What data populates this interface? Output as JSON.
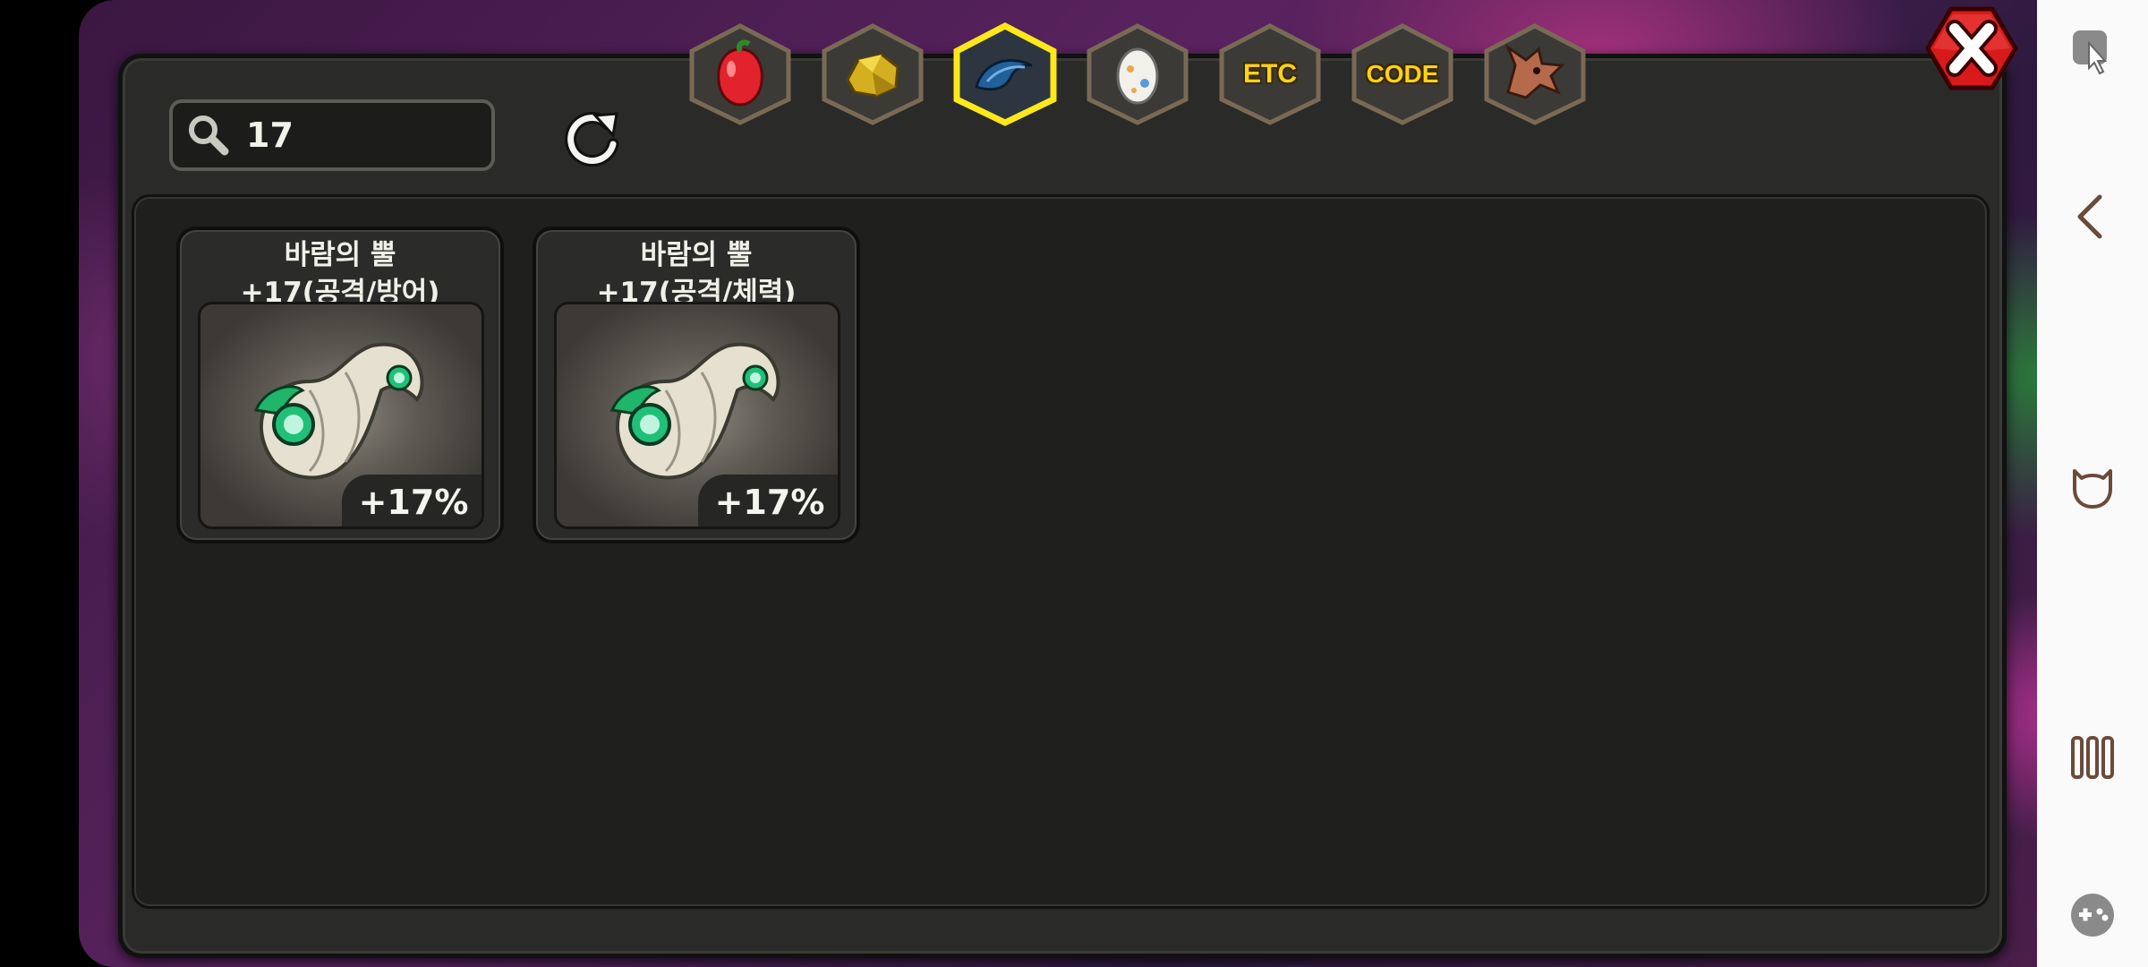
{
  "search": {
    "value": "17"
  },
  "tabs": [
    {
      "id": "fruit",
      "icon": "red-fruit-icon",
      "label": ""
    },
    {
      "id": "ore",
      "icon": "gold-ore-icon",
      "label": ""
    },
    {
      "id": "horn",
      "icon": "blue-horn-icon",
      "label": "",
      "selected": true
    },
    {
      "id": "egg",
      "icon": "egg-icon",
      "label": ""
    },
    {
      "id": "etc",
      "icon": "",
      "label": "ETC"
    },
    {
      "id": "code",
      "icon": "",
      "label": "CODE"
    },
    {
      "id": "dragon",
      "icon": "dragon-head-icon",
      "label": ""
    }
  ],
  "items": [
    {
      "name": "바람의 뿔",
      "stat": "+17(공격/방어)",
      "badge": "+17%",
      "icon": "wind-horn-icon"
    },
    {
      "name": "바람의 뿔",
      "stat": "+17(공격/체력)",
      "badge": "+17%",
      "icon": "wind-horn-icon"
    }
  ],
  "colors": {
    "selected_tab_border": "#ffe81a",
    "tab_label": "#ffd21a",
    "close_button": "#d81a1a"
  },
  "side_bar": [
    "touch-icon",
    "back-chevron-icon",
    "cat-face-icon",
    "menu-bars-icon",
    "gamepad-icon"
  ]
}
